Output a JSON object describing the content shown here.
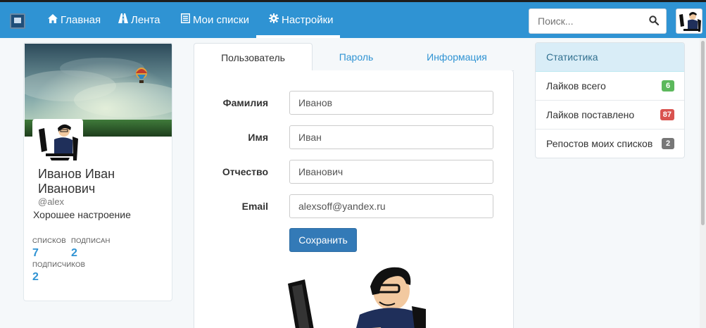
{
  "nav": {
    "items": [
      {
        "label": "Главная",
        "icon": "home-icon"
      },
      {
        "label": "Лента",
        "icon": "road-icon"
      },
      {
        "label": "Мои списки",
        "icon": "list-icon"
      },
      {
        "label": "Настройки",
        "icon": "gear-icon"
      }
    ],
    "active": "Настройки",
    "search_placeholder": "Поиск...",
    "accent": "#2f93d3"
  },
  "profile": {
    "full_name": "Иванов Иван Иванович",
    "username": "@alex",
    "status": "Хорошее настроение",
    "stats": [
      {
        "label": "СПИСКОВ",
        "value": "7"
      },
      {
        "label": "ПОДПИСАН",
        "value": "2"
      },
      {
        "label": "ПОДПИСЧИКОВ",
        "value": "2"
      }
    ]
  },
  "tabs": [
    {
      "label": "Пользователь",
      "active": true
    },
    {
      "label": "Пароль",
      "active": false
    },
    {
      "label": "Информация",
      "active": false
    }
  ],
  "form": {
    "fields": [
      {
        "label": "Фамилия",
        "value": "Иванов"
      },
      {
        "label": "Имя",
        "value": "Иван"
      },
      {
        "label": "Отчество",
        "value": "Иванович"
      },
      {
        "label": "Email",
        "value": "alexsoff@yandex.ru"
      }
    ],
    "save_label": "Сохранить"
  },
  "stats_panel": {
    "title": "Статистика",
    "rows": [
      {
        "label": "Лайков всего",
        "value": "6",
        "color": "#5cb85c"
      },
      {
        "label": "Лайков поставлено",
        "value": "87",
        "color": "#d9534f"
      },
      {
        "label": "Репостов моих списков",
        "value": "2",
        "color": "#777777"
      }
    ]
  }
}
